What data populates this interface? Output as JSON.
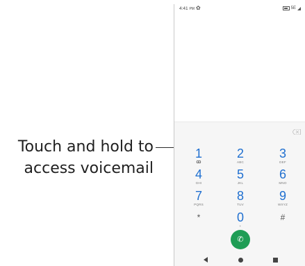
{
  "callout": {
    "line1": "Touch and hold to",
    "line2": "access voicemail"
  },
  "status_bar": {
    "time": "4:41",
    "ampm": "PM",
    "icons": [
      "settings-icon",
      "battery-icon",
      "signal-icon"
    ],
    "network": "5E"
  },
  "dialpad": {
    "keys": [
      {
        "digit": "1",
        "letters": "",
        "sub_icon": "voicemail-icon"
      },
      {
        "digit": "2",
        "letters": "ABC"
      },
      {
        "digit": "3",
        "letters": "DEF"
      },
      {
        "digit": "4",
        "letters": "GHI"
      },
      {
        "digit": "5",
        "letters": "JKL"
      },
      {
        "digit": "6",
        "letters": "MNO"
      },
      {
        "digit": "7",
        "letters": "PQRS"
      },
      {
        "digit": "8",
        "letters": "TUV"
      },
      {
        "digit": "9",
        "letters": "WXYZ"
      },
      {
        "digit": "*",
        "letters": ""
      },
      {
        "digit": "0",
        "letters": "+"
      },
      {
        "digit": "#",
        "letters": ""
      }
    ],
    "call_icon": "phone-icon",
    "backspace_icon": "backspace-icon"
  },
  "colors": {
    "digit": "#1f6fd0",
    "call_button": "#1f9d55"
  },
  "navbar": {
    "icons": [
      "back-icon",
      "home-icon",
      "recents-icon"
    ]
  }
}
